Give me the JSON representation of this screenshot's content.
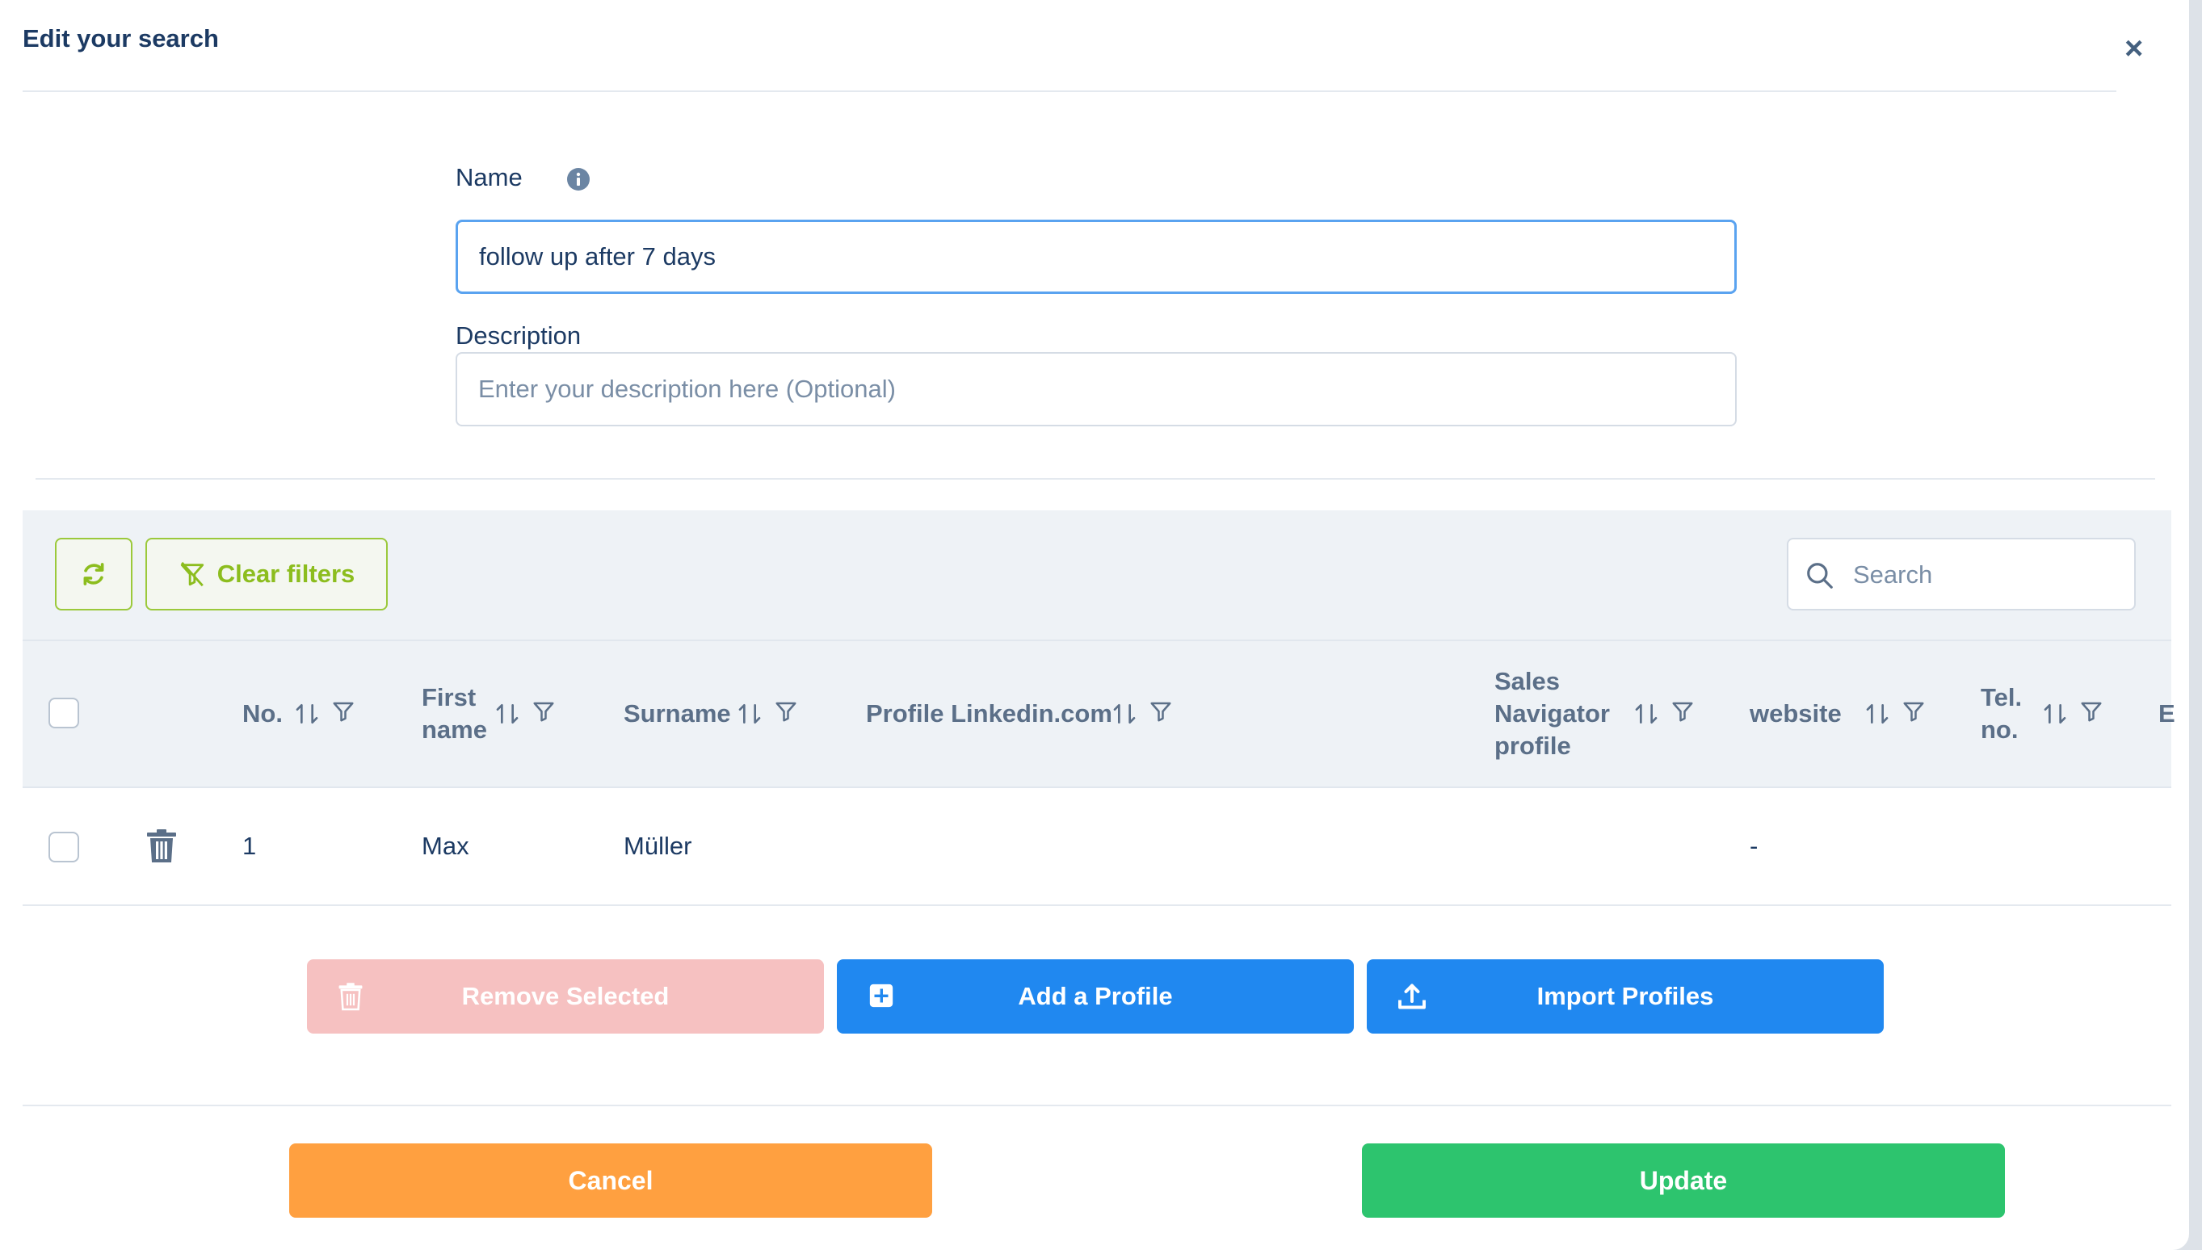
{
  "dialog": {
    "title": "Edit your search",
    "close_label": "×"
  },
  "form": {
    "name_label": "Name",
    "name_value": "follow up after 7 days",
    "description_label": "Description",
    "description_placeholder": "Enter your description here (Optional)"
  },
  "toolbar": {
    "clear_filters_label": "Clear filters",
    "search_placeholder": "Search"
  },
  "table": {
    "columns": {
      "no": "No.",
      "first_name_1": "First",
      "first_name_2": "name",
      "surname": "Surname",
      "profile_linkedin": "Profile Linkedin.com",
      "sales_nav_1": "Sales",
      "sales_nav_2": "Navigator",
      "sales_nav_3": "profile",
      "website": "website",
      "tel_1": "Tel.",
      "tel_2": "no.",
      "cut": "E"
    },
    "rows": [
      {
        "no": "1",
        "first_name": "Max",
        "surname": "Müller",
        "profile_linkedin": "",
        "sales_navigator": "",
        "website": "-",
        "tel": ""
      }
    ]
  },
  "actions": {
    "remove_selected": "Remove Selected",
    "add_profile": "Add a Profile",
    "import_profiles": "Import Profiles"
  },
  "footer": {
    "cancel": "Cancel",
    "update": "Update"
  },
  "colors": {
    "primary_blue": "#2088f0",
    "accent_green": "#8cbd1e",
    "cancel_orange": "#ffa040",
    "update_green": "#2dc46e",
    "remove_pink": "#f6c1c1",
    "text_navy": "#1c3a63"
  }
}
